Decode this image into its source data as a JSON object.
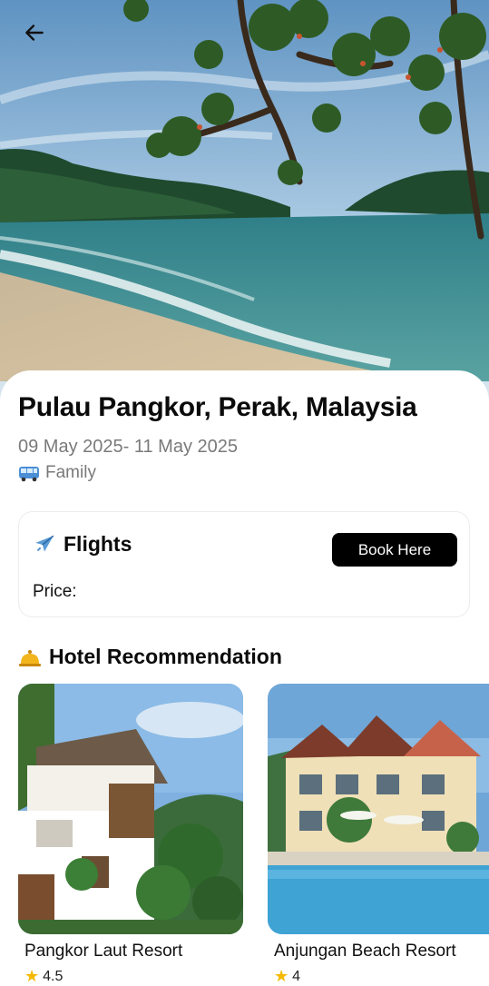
{
  "header": {
    "back_icon": "arrow-left-icon"
  },
  "trip": {
    "title": "Pulau Pangkor, Perak, Malaysia",
    "dates": "09 May 2025- 11 May 2025",
    "traveler_icon": "bus-icon",
    "traveler": "Family"
  },
  "flights": {
    "icon": "airplane-icon",
    "title": "Flights",
    "book_label": "Book Here",
    "price_label": "Price:"
  },
  "hotels": {
    "icon": "bell-icon",
    "title": "Hotel Recommendation",
    "items": [
      {
        "name": "Pangkor Laut Resort",
        "rating": "4.5",
        "rating_icon": "star-icon"
      },
      {
        "name": "Anjungan Beach Resort",
        "rating": "4",
        "rating_icon": "star-icon"
      }
    ]
  },
  "colors": {
    "primary_button": "#000000",
    "muted_text": "#7a7a7a",
    "star": "#f5b900"
  }
}
